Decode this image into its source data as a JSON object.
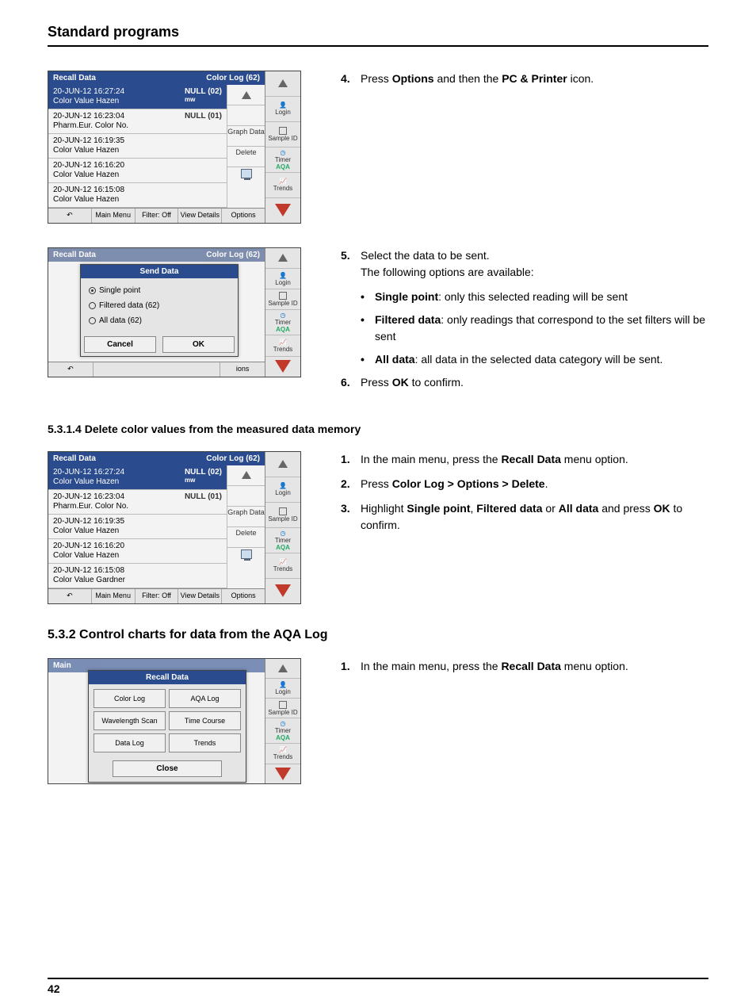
{
  "header": {
    "title": "Standard programs"
  },
  "footer": {
    "page": "42"
  },
  "step4": {
    "num": "4.",
    "text_pre": "Press ",
    "b1": "Options",
    "text_mid": " and then the ",
    "b2": "PC & Printer",
    "text_end": " icon."
  },
  "step5": {
    "num": "5.",
    "line1": "Select the data to be sent.",
    "line2": "The following options are available:",
    "bullets": [
      {
        "b": "Single point",
        "t": ": only this selected reading will be sent"
      },
      {
        "b": "Filtered data",
        "t": ": only readings that correspond to the set filters will be sent"
      },
      {
        "b": "All data",
        "t": ": all data in the selected data category will be sent."
      }
    ]
  },
  "step6": {
    "num": "6.",
    "pre": "Press ",
    "b": "OK",
    "post": " to confirm."
  },
  "sect_5314": {
    "heading": "5.3.1.4   Delete color values from the measured data memory",
    "s1": {
      "num": "1.",
      "pre": "In the main menu, press the ",
      "b": "Recall Data",
      "post": " menu option."
    },
    "s2": {
      "num": "2.",
      "pre": "Press ",
      "b": "Color Log > Options > Delete",
      "post": "."
    },
    "s3": {
      "num": "3.",
      "pre": "Highlight ",
      "b1": "Single point",
      "mid1": ", ",
      "b2": "Filtered data",
      "mid2": " or ",
      "b3": "All data",
      "mid3": " and press ",
      "b4": "OK",
      "post": " to confirm."
    }
  },
  "sect_532": {
    "heading": "5.3.2   Control charts for data from the AQA Log",
    "s1": {
      "num": "1.",
      "pre": "In the main menu, press the ",
      "b": "Recall Data",
      "post": " menu option."
    }
  },
  "device_recall": {
    "title": "Recall Data",
    "titleRight": "Color Log (62)",
    "rows": [
      {
        "t1": "20-JUN-12  16:27:24",
        "t2": "Color Value Hazen",
        "r": "NULL (02)",
        "r2": "mw",
        "sel": true
      },
      {
        "t1": "20-JUN-12  16:23:04",
        "t2": "Pharm.Eur. Color No.",
        "r": "NULL (01)"
      },
      {
        "t1": "20-JUN-12  16:19:35",
        "t2": "Color Value Hazen",
        "r": ""
      },
      {
        "t1": "20-JUN-12  16:16:20",
        "t2": "Color Value Hazen",
        "r": ""
      },
      {
        "t1": "20-JUN-12  16:15:08",
        "t2": "Color Value Hazen",
        "r": ""
      }
    ],
    "actions": [
      "",
      "Graph Data",
      "Delete",
      ""
    ],
    "btnbar": [
      "Main Menu",
      "Filter: Off",
      "View Details",
      "Options"
    ]
  },
  "device_recall2_lastrow": {
    "t1": "20-JUN-12  16:15:08",
    "t2": "Color Value Gardner"
  },
  "send_data": {
    "title": "Send Data",
    "opt1": "Single point",
    "opt2": "Filtered data (62)",
    "opt3": "All data (62)",
    "cancel": "Cancel",
    "ok": "OK"
  },
  "sidebar": {
    "login": "Login",
    "sample": "Sample ID",
    "timer": "Timer",
    "aqa": "AQA",
    "trends": "Trends"
  },
  "recall_dialog": {
    "title": "Recall Data",
    "cells": [
      "Color Log",
      "AQA Log",
      "Wavelength Scan",
      "Time Course",
      "Data Log",
      "Trends"
    ],
    "close": "Close"
  },
  "main_menu_label": "Main"
}
